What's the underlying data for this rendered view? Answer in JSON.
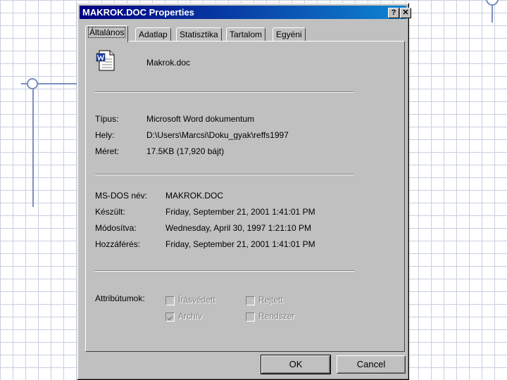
{
  "window": {
    "title": "MAKROK.DOC Properties",
    "help_glyph": "?",
    "close_glyph": "✕"
  },
  "tabs": [
    {
      "label": "Általános",
      "active": true
    },
    {
      "label": "Adatlap",
      "active": false
    },
    {
      "label": "Statisztika",
      "active": false
    },
    {
      "label": "Tartalom",
      "active": false
    },
    {
      "label": "Egyéni",
      "active": false
    }
  ],
  "file": {
    "icon": "word-document-icon",
    "name": "Makrok.doc"
  },
  "details": {
    "type_label": "Típus:",
    "type_value": "Microsoft Word dokumentum",
    "location_label": "Hely:",
    "location_value": "D:\\Users\\Marcsi\\Doku_gyak\\reffs1997",
    "size_label": "Méret:",
    "size_value": "17.5KB (17,920 bájt)"
  },
  "dates": {
    "msdos_label": "MS-DOS név:",
    "msdos_value": "MAKROK.DOC",
    "created_label": "Készült:",
    "created_value": "Friday, September 21, 2001 1:41:01 PM",
    "modified_label": "Módosítva:",
    "modified_value": "Wednesday, April 30, 1997 1:21:10 PM",
    "accessed_label": "Hozzáférés:",
    "accessed_value": "Friday, September 21, 2001 1:41:01 PM"
  },
  "attributes": {
    "label": "Attribútumok:",
    "readonly_label": "Írásvédett",
    "readonly_checked": false,
    "hidden_label": "Rejtett",
    "hidden_checked": false,
    "archive_label": "Archív",
    "archive_checked": true,
    "system_label": "Rendszer",
    "system_checked": false
  },
  "buttons": {
    "ok_label": "OK",
    "cancel_label": "Cancel"
  },
  "colors": {
    "titlebar": "#000080",
    "dialog_face": "#c0c0c0",
    "slide_grid": "#c8cfe0",
    "slide_accent": "#7b8fbf"
  }
}
